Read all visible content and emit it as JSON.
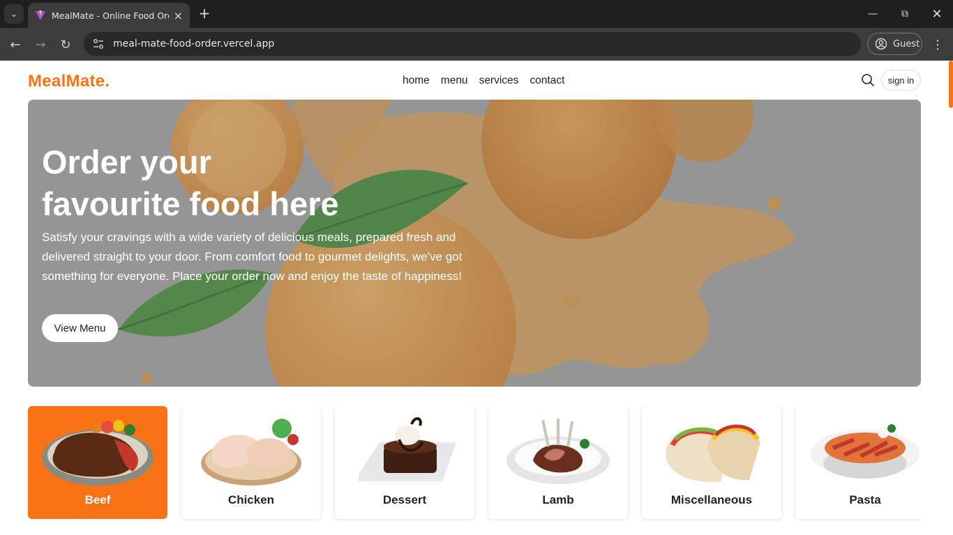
{
  "browser": {
    "tab_title": "MealMate - Online Food Ordering",
    "url": "meal-mate-food-order.vercel.app",
    "profile_label": "Guest"
  },
  "header": {
    "logo": "MealMate.",
    "nav": [
      "home",
      "menu",
      "services",
      "contact"
    ],
    "signin_label": "sign in"
  },
  "hero": {
    "title_line1": "Order your",
    "title_line2": "favourite food here",
    "subtitle": "Satisfy your cravings with a wide variety of delicious meals, prepared fresh and delivered straight to your door. From comfort food to gourmet delights, we've got something for everyone. Place your order now and enjoy the taste of happiness!",
    "button_label": "View Menu"
  },
  "categories": [
    {
      "label": "Beef",
      "icon": "beef-steak-icon",
      "active": true
    },
    {
      "label": "Chicken",
      "icon": "chicken-icon",
      "active": false
    },
    {
      "label": "Dessert",
      "icon": "dessert-icon",
      "active": false
    },
    {
      "label": "Lamb",
      "icon": "lamb-icon",
      "active": false
    },
    {
      "label": "Miscellaneous",
      "icon": "taco-icon",
      "active": false
    },
    {
      "label": "Pasta",
      "icon": "pasta-icon",
      "active": false
    }
  ],
  "colors": {
    "accent": "#f97316",
    "chrome_dark": "#1f1f1f",
    "chrome_toolbar": "#3c3c3c"
  }
}
